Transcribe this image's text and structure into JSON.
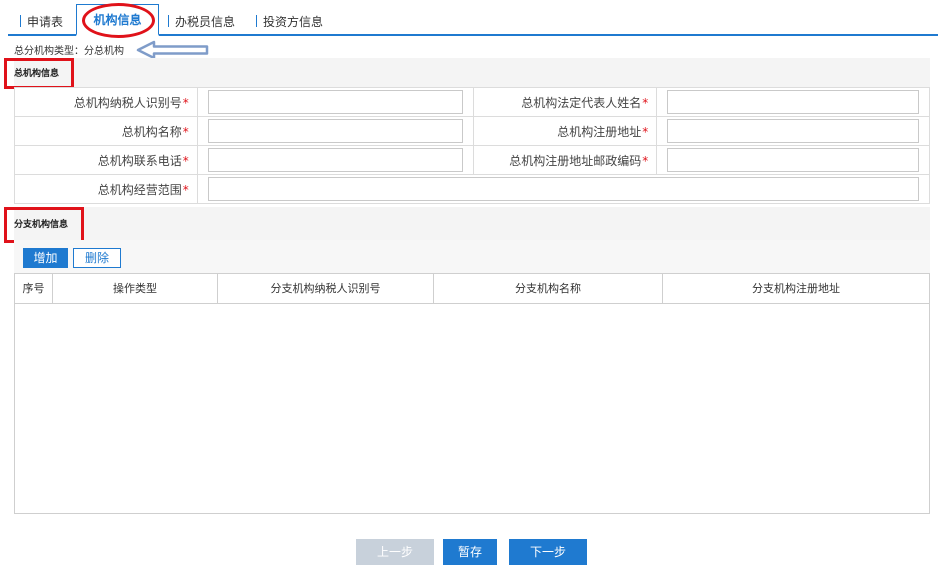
{
  "tabs": {
    "application": "申请表",
    "org_info": "机构信息",
    "taxpayer_staff": "办税员信息",
    "investor": "投资方信息"
  },
  "org_type": "总分机构类型：分总机构",
  "hq_section": {
    "title": "总机构信息",
    "fields": {
      "tax_id": "总机构纳税人识别号",
      "legal_rep": "总机构法定代表人姓名",
      "name": "总机构名称",
      "reg_address": "总机构注册地址",
      "phone": "总机构联系电话",
      "postcode": "总机构注册地址邮政编码",
      "scope": "总机构经营范围"
    },
    "required_mark": "*"
  },
  "branch_section": {
    "title": "分支机构信息",
    "add_label": "增加",
    "delete_label": "删除",
    "columns": [
      "序号",
      "操作类型",
      "分支机构纳税人识别号",
      "分支机构名称",
      "分支机构注册地址"
    ]
  },
  "footer": {
    "prev_label": "上一步",
    "save_label": "暂存",
    "next_label": "下一步"
  },
  "colors": {
    "accent": "#1f7ad0",
    "annotation_red": "#e0121a",
    "disabled": "#c8d1db"
  }
}
